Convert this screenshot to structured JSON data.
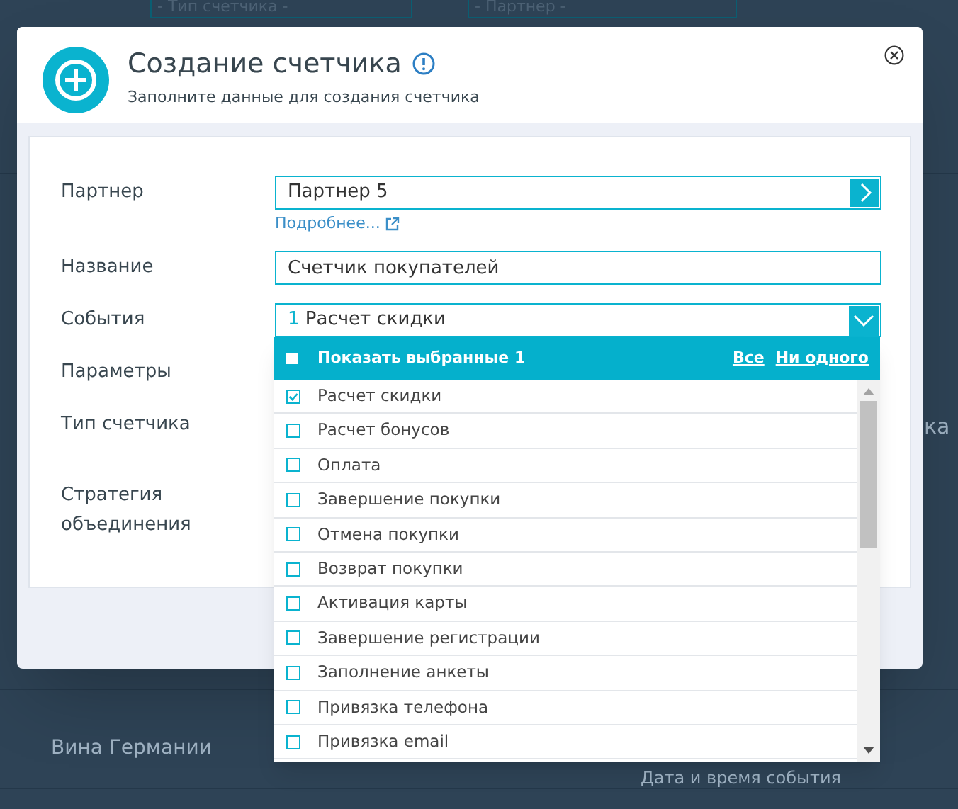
{
  "background": {
    "filters": [
      {
        "placeholder": "- Тип счетчика -"
      },
      {
        "placeholder": "- Партнер -"
      }
    ],
    "cells": [
      "ка",
      "Вина Германии",
      "Дата и время события"
    ]
  },
  "dialog": {
    "title": "Создание счетчика",
    "subtitle": "Заполните данные для создания счетчика",
    "fields": [
      {
        "label": "Партнер",
        "kind": "picker",
        "value": "Партнер 5",
        "link": "Подробнее..."
      },
      {
        "label": "Название",
        "kind": "text",
        "value": "Счетчик покупателей"
      },
      {
        "label": "События",
        "kind": "multiselect",
        "count": "1",
        "value": "Расчет скидки"
      },
      {
        "label": "Параметры",
        "kind": "covered"
      },
      {
        "label": "Тип счетчика",
        "kind": "covered"
      },
      {
        "label": "Стратегия объединения",
        "kind": "covered"
      }
    ]
  },
  "dropdown": {
    "show_selected": "Показать выбранные 1",
    "all": "Все",
    "none": "Ни одного",
    "options": [
      {
        "label": "Расчет скидки",
        "checked": true
      },
      {
        "label": "Расчет бонусов",
        "checked": false
      },
      {
        "label": "Оплата",
        "checked": false
      },
      {
        "label": "Завершение покупки",
        "checked": false
      },
      {
        "label": "Отмена покупки",
        "checked": false
      },
      {
        "label": "Возврат покупки",
        "checked": false
      },
      {
        "label": "Активация карты",
        "checked": false
      },
      {
        "label": "Завершение регистрации",
        "checked": false
      },
      {
        "label": "Заполнение анкеты",
        "checked": false
      },
      {
        "label": "Привязка телефона",
        "checked": false
      },
      {
        "label": "Привязка email",
        "checked": false
      }
    ]
  }
}
